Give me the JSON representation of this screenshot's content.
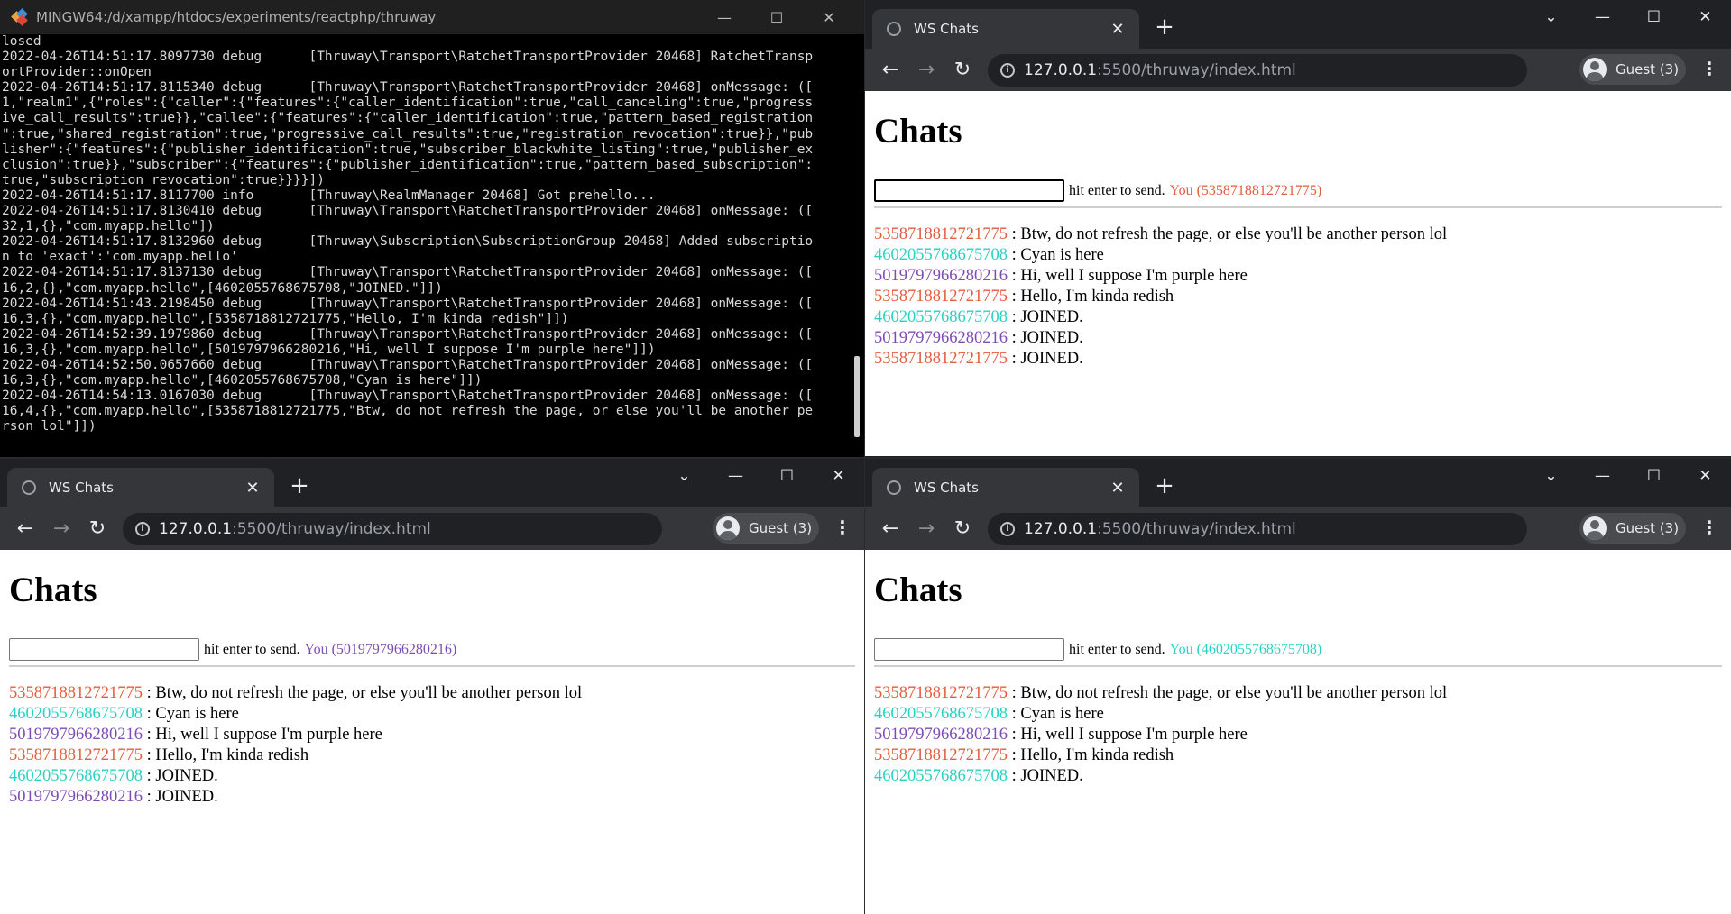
{
  "terminal": {
    "title": "MINGW64:/d/xampp/htdocs/experiments/reactphp/thruway",
    "controls": [
      "—",
      "☐",
      "✕"
    ],
    "lines": [
      "losed",
      "2022-04-26T14:51:17.8097730 debug      [Thruway\\Transport\\RatchetTransportProvider 20468] RatchetTransp",
      "ortProvider::onOpen",
      "2022-04-26T14:51:17.8115340 debug      [Thruway\\Transport\\RatchetTransportProvider 20468] onMessage: ([",
      "1,\"realm1\",{\"roles\":{\"caller\":{\"features\":{\"caller_identification\":true,\"call_canceling\":true,\"progress",
      "ive_call_results\":true}},\"callee\":{\"features\":{\"caller_identification\":true,\"pattern_based_registration",
      "\":true,\"shared_registration\":true,\"progressive_call_results\":true,\"registration_revocation\":true}},\"pub",
      "lisher\":{\"features\":{\"publisher_identification\":true,\"subscriber_blackwhite_listing\":true,\"publisher_ex",
      "clusion\":true}},\"subscriber\":{\"features\":{\"publisher_identification\":true,\"pattern_based_subscription\":",
      "true,\"subscription_revocation\":true}}}}])",
      "2022-04-26T14:51:17.8117700 info       [Thruway\\RealmManager 20468] Got prehello...",
      "2022-04-26T14:51:17.8130410 debug      [Thruway\\Transport\\RatchetTransportProvider 20468] onMessage: ([",
      "32,1,{},\"com.myapp.hello\"])",
      "2022-04-26T14:51:17.8132960 debug      [Thruway\\Subscription\\SubscriptionGroup 20468] Added subscriptio",
      "n to 'exact':'com.myapp.hello'",
      "2022-04-26T14:51:17.8137130 debug      [Thruway\\Transport\\RatchetTransportProvider 20468] onMessage: ([",
      "16,2,{},\"com.myapp.hello\",[4602055768675708,\"JOINED.\"]])",
      "2022-04-26T14:51:43.2198450 debug      [Thruway\\Transport\\RatchetTransportProvider 20468] onMessage: ([",
      "16,3,{},\"com.myapp.hello\",[5358718812721775,\"Hello, I'm kinda redish\"]])",
      "2022-04-26T14:52:39.1979860 debug      [Thruway\\Transport\\RatchetTransportProvider 20468] onMessage: ([",
      "16,3,{},\"com.myapp.hello\",[5019797966280216,\"Hi, well I suppose I'm purple here\"]])",
      "2022-04-26T14:52:50.0657660 debug      [Thruway\\Transport\\RatchetTransportProvider 20468] onMessage: ([",
      "16,3,{},\"com.myapp.hello\",[4602055768675708,\"Cyan is here\"]])",
      "2022-04-26T14:54:13.0167030 debug      [Thruway\\Transport\\RatchetTransportProvider 20468] onMessage: ([",
      "16,4,{},\"com.myapp.hello\",[5358718812721775,\"Btw, do not refresh the page, or else you'll be another pe",
      "rson lol\"]])"
    ]
  },
  "colors": {
    "red": "#e35d3f",
    "cyan": "#2bd1c4",
    "purple": "#7e4bb5"
  },
  "browsers": [
    {
      "tab_title": "WS Chats",
      "url_host": "127.0.0.1",
      "url_rest": ":5500/thruway/index.html",
      "profile": "Guest (3)",
      "heading": "Chats",
      "hint": "hit enter to send.",
      "you_label": "You (5358718812721775)",
      "you_color": "red",
      "messages": [
        {
          "id": "5358718812721775",
          "color": "red",
          "text": " : Btw, do not refresh the page, or else you'll be another person lol"
        },
        {
          "id": "4602055768675708",
          "color": "cyan",
          "text": " : Cyan is here"
        },
        {
          "id": "5019797966280216",
          "color": "purple",
          "text": " : Hi, well I suppose I'm purple here"
        },
        {
          "id": "5358718812721775",
          "color": "red",
          "text": " : Hello, I'm kinda redish"
        },
        {
          "id": "4602055768675708",
          "color": "cyan",
          "text": " : JOINED."
        },
        {
          "id": "5019797966280216",
          "color": "purple",
          "text": " : JOINED."
        },
        {
          "id": "5358718812721775",
          "color": "red",
          "text": " : JOINED."
        }
      ]
    },
    {
      "tab_title": "WS Chats",
      "url_host": "127.0.0.1",
      "url_rest": ":5500/thruway/index.html",
      "profile": "Guest (3)",
      "heading": "Chats",
      "hint": "hit enter to send.",
      "you_label": "You (5019797966280216)",
      "you_color": "purple",
      "messages": [
        {
          "id": "5358718812721775",
          "color": "red",
          "text": " : Btw, do not refresh the page, or else you'll be another person lol"
        },
        {
          "id": "4602055768675708",
          "color": "cyan",
          "text": " : Cyan is here"
        },
        {
          "id": "5019797966280216",
          "color": "purple",
          "text": " : Hi, well I suppose I'm purple here"
        },
        {
          "id": "5358718812721775",
          "color": "red",
          "text": " : Hello, I'm kinda redish"
        },
        {
          "id": "4602055768675708",
          "color": "cyan",
          "text": " : JOINED."
        },
        {
          "id": "5019797966280216",
          "color": "purple",
          "text": " : JOINED."
        }
      ]
    },
    {
      "tab_title": "WS Chats",
      "url_host": "127.0.0.1",
      "url_rest": ":5500/thruway/index.html",
      "profile": "Guest (3)",
      "heading": "Chats",
      "hint": "hit enter to send.",
      "you_label": "You (4602055768675708)",
      "you_color": "cyan",
      "messages": [
        {
          "id": "5358718812721775",
          "color": "red",
          "text": " : Btw, do not refresh the page, or else you'll be another person lol"
        },
        {
          "id": "4602055768675708",
          "color": "cyan",
          "text": " : Cyan is here"
        },
        {
          "id": "5019797966280216",
          "color": "purple",
          "text": " : Hi, well I suppose I'm purple here"
        },
        {
          "id": "5358718812721775",
          "color": "red",
          "text": " : Hello, I'm kinda redish"
        },
        {
          "id": "4602055768675708",
          "color": "cyan",
          "text": " : JOINED."
        }
      ]
    }
  ]
}
